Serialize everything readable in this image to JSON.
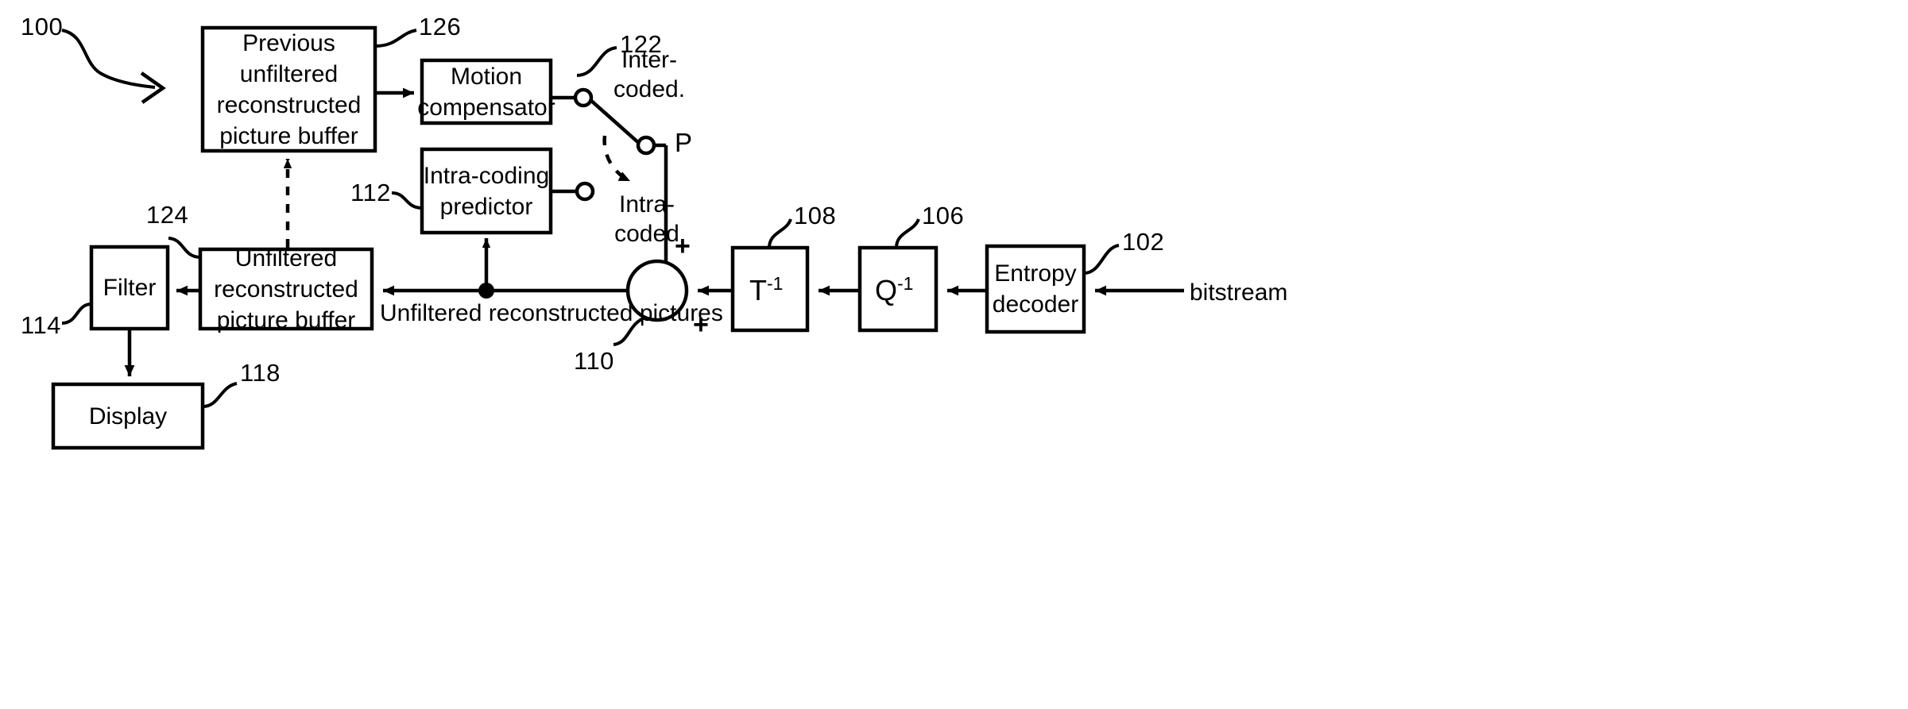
{
  "figure": {
    "figure_number": "100",
    "blocks": [
      {
        "id": "previous_buffer",
        "label": "Previous\nunfiltered\nreconstructed\npicture buffer",
        "ref": "126"
      },
      {
        "id": "motion_compensator",
        "label": "Motion\ncompensator",
        "ref": "122"
      },
      {
        "id": "intra_predictor",
        "label": "Intra-coding\npredictor",
        "ref": "112"
      },
      {
        "id": "unfiltered_buffer",
        "label": "Unfiltered\nreconstructed\npicture buffer",
        "ref": "124"
      },
      {
        "id": "filter",
        "label": "Filter",
        "ref": "114"
      },
      {
        "id": "display",
        "label": "Display",
        "ref": "118"
      },
      {
        "id": "inverse_transform",
        "label": "T",
        "superscript": "-1",
        "ref": "108"
      },
      {
        "id": "inverse_quantizer",
        "label": "Q",
        "superscript": "-1",
        "ref": "106"
      },
      {
        "id": "entropy_decoder",
        "label": "Entropy\ndecoder",
        "ref": "102"
      },
      {
        "id": "summer",
        "label": "",
        "ref": "110"
      }
    ],
    "signal_labels": {
      "inter_coded": "Inter-\ncoded.",
      "intra_coded": "Intra-\ncoded",
      "prediction_node": "P",
      "unfiltered_pictures": "Unfiltered reconstructed pictures",
      "bitstream": "bitstream",
      "plus_top": "+",
      "plus_bottom": "+"
    },
    "reference_numerals": {
      "figure": "100",
      "entropy_decoder": "102",
      "inverse_quantizer": "106",
      "inverse_transform": "108",
      "summer": "110",
      "intra_predictor": "112",
      "filter": "114",
      "display": "118",
      "motion_compensator": "122",
      "unfiltered_buffer": "124",
      "previous_buffer": "126"
    },
    "colors": {
      "stroke": "#000000",
      "background": "#ffffff"
    }
  }
}
